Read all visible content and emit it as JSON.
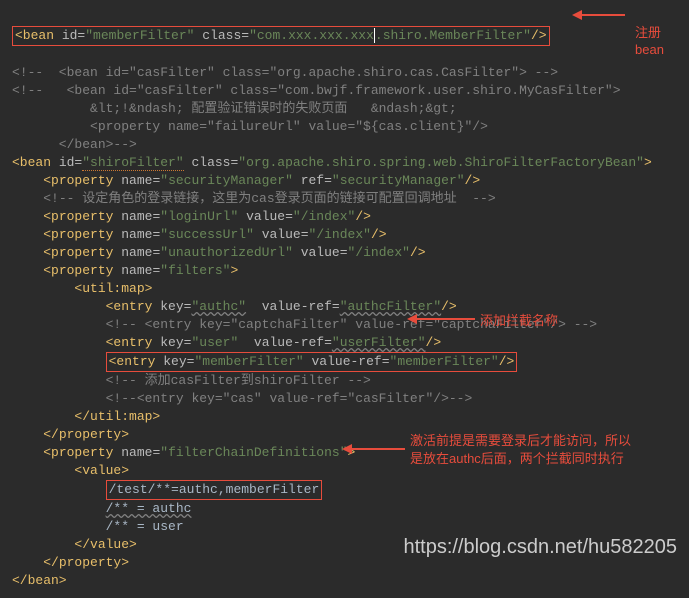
{
  "line1": {
    "bean_open": "<bean",
    "id_attr": "id=",
    "id_val": "\"memberFilter\"",
    "class_attr": "class=",
    "class_val1": "\"com.xxx.xxx.xxx",
    "class_val2": ".shiro.MemberFilter\"",
    "close": "/>"
  },
  "comment1": "<!--  <bean id=\"casFilter\" class=\"org.apache.shiro.cas.CasFilter\"> -->",
  "comment2a": "<!--   <bean id=\"casFilter\" class=\"com.bwjf.framework.user.shiro.MyCasFilter\">",
  "comment2b": "          &lt;!&ndash; 配置验证错误时的失败页面   &ndash;&gt;",
  "comment2c": "          <property name=\"failureUrl\" value=\"${cas.client}\"/>",
  "comment2d": "      </bean>-->",
  "bean2": {
    "open": "<bean",
    "id_attr": "id=",
    "id_val": "\"shiroFilter\"",
    "class_attr": "class=",
    "class_val": "\"org.apache.shiro.spring.web.ShiroFilterFactoryBean\"",
    "close": ">"
  },
  "prop1": {
    "open": "<property",
    "name": "name=",
    "nameval": "\"securityManager\"",
    "ref": "ref=",
    "refval": "\"securityManager\"",
    "close": "/>"
  },
  "comment3": "<!-- 设定角色的登录链接，这里为cas登录页面的链接可配置回调地址  -->",
  "prop2": {
    "open": "<property",
    "name": "name=",
    "nameval": "\"loginUrl\"",
    "val": "value=",
    "valval": "\"/index\"",
    "close": "/>"
  },
  "prop3": {
    "open": "<property",
    "name": "name=",
    "nameval": "\"successUrl\"",
    "val": "value=",
    "valval": "\"/index\"",
    "close": "/>"
  },
  "prop4": {
    "open": "<property",
    "name": "name=",
    "nameval": "\"unauthorizedUrl\"",
    "val": "value=",
    "valval": "\"/index\"",
    "close": "/>"
  },
  "prop5": {
    "open": "<property",
    "name": "name=",
    "nameval": "\"filters\"",
    "close": ">"
  },
  "utilmap_open": "<util:map>",
  "entry1": {
    "open": "<entry",
    "key": "key=",
    "keyval": "\"authc\"",
    "vr": "value-ref=",
    "vrval": "\"authcFilter\"",
    "close": "/>"
  },
  "entry_comment": "<!-- <entry key=\"captchaFilter\" value-ref=\"captchaFilter\"/> -->",
  "entry2": {
    "open": "<entry",
    "key": "key=",
    "keyval": "\"user\"",
    "vr": "value-ref=",
    "vrval": "\"userFilter\"",
    "close": "/>"
  },
  "entry3": {
    "open": "<entry",
    "key": "key=",
    "keyval": "\"memberFilter\"",
    "vr": "value-ref=",
    "vrval": "\"memberFilter\"",
    "close": "/>"
  },
  "comment4": "<!-- 添加casFilter到shiroFilter -->",
  "comment5": "<!--<entry key=\"cas\" value-ref=\"casFilter\"/>-->",
  "utilmap_close": "</util:map>",
  "prop_close": "</property>",
  "prop6": {
    "open": "<property",
    "name": "name=",
    "nameval": "\"filterChainDefinitions\"",
    "close": ">"
  },
  "value_open": "<value>",
  "chain1": "/test/**=authc,memberFilter",
  "chain2": "/** = authc",
  "chain3": "/** = user",
  "value_close": "</value>",
  "bean_close": "</bean>",
  "annotation1a": "注册",
  "annotation1b": "bean",
  "annotation2": "添加拦截名称",
  "annotation3a": "激活前提是需要登录后才能访问，所以",
  "annotation3b": "是放在authc后面，两个拦截同时执行",
  "watermark": "https://blog.csdn.net/hu582205"
}
